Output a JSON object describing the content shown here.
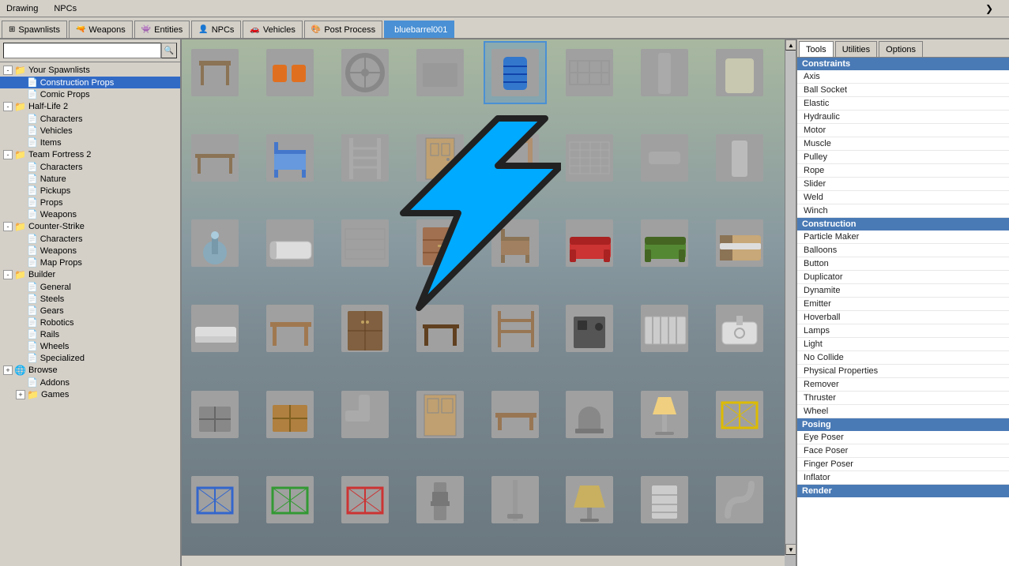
{
  "menubar": {
    "items": [
      "Drawing",
      "NPCs"
    ],
    "arrow": "❯"
  },
  "tabs": [
    {
      "id": "spawnlists",
      "label": "Spawnlists",
      "icon": "⊞",
      "active": false
    },
    {
      "id": "weapons",
      "label": "Weapons",
      "icon": "🔫",
      "active": false
    },
    {
      "id": "entities",
      "label": "Entities",
      "icon": "👾",
      "active": false
    },
    {
      "id": "npcs",
      "label": "NPCs",
      "icon": "👤",
      "active": false
    },
    {
      "id": "vehicles",
      "label": "Vehicles",
      "icon": "🚗",
      "active": false
    },
    {
      "id": "postprocess",
      "label": "Post Process",
      "icon": "🎨",
      "active": false
    },
    {
      "id": "bluebarrel001",
      "label": "bluebarrel001",
      "icon": "",
      "active": true
    }
  ],
  "search": {
    "placeholder": "",
    "button_icon": "🔍"
  },
  "tree": {
    "root_label": "Your Spawnlists",
    "items": [
      {
        "id": "your-spawnlists",
        "label": "Your Spawnlists",
        "level": 0,
        "toggle": "-",
        "icon": "folder",
        "expanded": true
      },
      {
        "id": "construction-props",
        "label": "Construction Props",
        "level": 1,
        "toggle": null,
        "icon": "file",
        "selected": true
      },
      {
        "id": "comic-props",
        "label": "Comic Props",
        "level": 1,
        "toggle": null,
        "icon": "file"
      },
      {
        "id": "half-life-2",
        "label": "Half-Life 2",
        "level": 0,
        "toggle": "-",
        "icon": "folder-hl2",
        "expanded": true
      },
      {
        "id": "hl2-characters",
        "label": "Characters",
        "level": 1,
        "toggle": null,
        "icon": "file"
      },
      {
        "id": "hl2-vehicles",
        "label": "Vehicles",
        "level": 1,
        "toggle": null,
        "icon": "file"
      },
      {
        "id": "hl2-items",
        "label": "Items",
        "level": 1,
        "toggle": null,
        "icon": "file"
      },
      {
        "id": "team-fortress-2",
        "label": "Team Fortress 2",
        "level": 0,
        "toggle": "-",
        "icon": "folder-tf2",
        "expanded": true
      },
      {
        "id": "tf2-characters",
        "label": "Characters",
        "level": 1,
        "toggle": null,
        "icon": "file"
      },
      {
        "id": "tf2-nature",
        "label": "Nature",
        "level": 1,
        "toggle": null,
        "icon": "file"
      },
      {
        "id": "tf2-pickups",
        "label": "Pickups",
        "level": 1,
        "toggle": null,
        "icon": "file"
      },
      {
        "id": "tf2-props",
        "label": "Props",
        "level": 1,
        "toggle": null,
        "icon": "file"
      },
      {
        "id": "tf2-weapons",
        "label": "Weapons",
        "level": 1,
        "toggle": null,
        "icon": "file"
      },
      {
        "id": "counter-strike",
        "label": "Counter-Strike",
        "level": 0,
        "toggle": "-",
        "icon": "folder-cs",
        "expanded": true
      },
      {
        "id": "cs-characters",
        "label": "Characters",
        "level": 1,
        "toggle": null,
        "icon": "file"
      },
      {
        "id": "cs-weapons",
        "label": "Weapons",
        "level": 1,
        "toggle": null,
        "icon": "file"
      },
      {
        "id": "cs-map-props",
        "label": "Map Props",
        "level": 1,
        "toggle": null,
        "icon": "file"
      },
      {
        "id": "builder",
        "label": "Builder",
        "level": 0,
        "toggle": "-",
        "icon": "folder",
        "expanded": true
      },
      {
        "id": "builder-general",
        "label": "General",
        "level": 1,
        "toggle": null,
        "icon": "file"
      },
      {
        "id": "builder-steels",
        "label": "Steels",
        "level": 1,
        "toggle": null,
        "icon": "file"
      },
      {
        "id": "builder-gears",
        "label": "Gears",
        "level": 1,
        "toggle": null,
        "icon": "file"
      },
      {
        "id": "builder-robotics",
        "label": "Robotics",
        "level": 1,
        "toggle": null,
        "icon": "file"
      },
      {
        "id": "builder-rails",
        "label": "Rails",
        "level": 1,
        "toggle": null,
        "icon": "file"
      },
      {
        "id": "builder-wheels",
        "label": "Wheels",
        "level": 1,
        "toggle": null,
        "icon": "file"
      },
      {
        "id": "builder-specialized",
        "label": "Specialized",
        "level": 1,
        "toggle": null,
        "icon": "file"
      },
      {
        "id": "browse",
        "label": "Browse",
        "level": 0,
        "toggle": "+",
        "icon": "folder-browse",
        "expanded": false
      },
      {
        "id": "browse-addons",
        "label": "Addons",
        "level": 1,
        "toggle": null,
        "icon": "file"
      },
      {
        "id": "browse-games",
        "label": "Games",
        "level": 1,
        "toggle": "+",
        "icon": "folder"
      }
    ]
  },
  "right_panel": {
    "tabs": [
      {
        "id": "tools",
        "label": "Tools",
        "active": true
      },
      {
        "id": "utilities",
        "label": "Utilities",
        "active": false
      },
      {
        "id": "options",
        "label": "Options",
        "active": false
      }
    ],
    "sections": [
      {
        "header": "Constraints",
        "items": [
          "Axis",
          "Ball Socket",
          "Elastic",
          "Hydraulic",
          "Motor",
          "Muscle",
          "Pulley",
          "Rope",
          "Slider",
          "Weld",
          "Winch"
        ]
      },
      {
        "header": "Construction",
        "items": [
          "Particle Maker",
          "Balloons",
          "Button",
          "Duplicator",
          "Dynamite",
          "Emitter",
          "Hoverball",
          "Lamps",
          "Light",
          "No Collide",
          "Physical Properties",
          "Remover",
          "Thruster",
          "Wheel"
        ]
      },
      {
        "header": "Posing",
        "items": [
          "Eye Poser",
          "Face Poser",
          "Finger Poser",
          "Inflator"
        ]
      },
      {
        "header": "Render",
        "items": []
      }
    ]
  },
  "sprites": [
    {
      "id": 1,
      "label": "stool"
    },
    {
      "id": 2,
      "label": "drums"
    },
    {
      "id": 3,
      "label": "wheel"
    },
    {
      "id": 4,
      "label": "plate"
    },
    {
      "id": 5,
      "label": "barrel-blue",
      "selected": true
    },
    {
      "id": 6,
      "label": "fence"
    },
    {
      "id": 7,
      "label": "pipe-tall"
    },
    {
      "id": 8,
      "label": "tank"
    },
    {
      "id": 9,
      "label": "table-stool"
    },
    {
      "id": 10,
      "label": "chair-blue"
    },
    {
      "id": 11,
      "label": "ladder"
    },
    {
      "id": 12,
      "label": "door-panel"
    },
    {
      "id": 13,
      "label": "door-frame"
    },
    {
      "id": 14,
      "label": "fence2"
    },
    {
      "id": 15,
      "label": "pipe"
    },
    {
      "id": 16,
      "label": "cylinder"
    },
    {
      "id": 17,
      "label": "fountain"
    },
    {
      "id": 18,
      "label": "bathtub"
    },
    {
      "id": 19,
      "label": "fence-wire"
    },
    {
      "id": 20,
      "label": "dresser"
    },
    {
      "id": 21,
      "label": "chair-wood"
    },
    {
      "id": 22,
      "label": "sofa-red"
    },
    {
      "id": 23,
      "label": "sofa-green"
    },
    {
      "id": 24,
      "label": "bed"
    },
    {
      "id": 25,
      "label": "mattress"
    },
    {
      "id": 26,
      "label": "table-wood"
    },
    {
      "id": 27,
      "label": "cabinet"
    },
    {
      "id": 28,
      "label": "table-dark"
    },
    {
      "id": 29,
      "label": "shelf"
    },
    {
      "id": 30,
      "label": "stove"
    },
    {
      "id": 31,
      "label": "radiator"
    },
    {
      "id": 32,
      "label": "sink"
    },
    {
      "id": 33,
      "label": "box-metal"
    },
    {
      "id": 34,
      "label": "crate"
    },
    {
      "id": 35,
      "label": "pipe-corner"
    },
    {
      "id": 36,
      "label": "door2"
    },
    {
      "id": 37,
      "label": "bench"
    },
    {
      "id": 38,
      "label": "tombstone"
    },
    {
      "id": 39,
      "label": "lamp"
    },
    {
      "id": 40,
      "label": "cage-yellow"
    },
    {
      "id": 41,
      "label": "cage-blue"
    },
    {
      "id": 42,
      "label": "cage-green"
    },
    {
      "id": 43,
      "label": "cage-red"
    },
    {
      "id": 44,
      "label": "tower"
    },
    {
      "id": 45,
      "label": "pole"
    },
    {
      "id": 46,
      "label": "lampshade"
    },
    {
      "id": 47,
      "label": "heater"
    },
    {
      "id": 48,
      "label": "plumbing"
    }
  ],
  "colors": {
    "tab_active_bg": "#4a90d4",
    "category_header_bg": "#4a7ab5",
    "selected_item_bg": "#316ac5",
    "tree_selected_bg": "#316ac5"
  }
}
